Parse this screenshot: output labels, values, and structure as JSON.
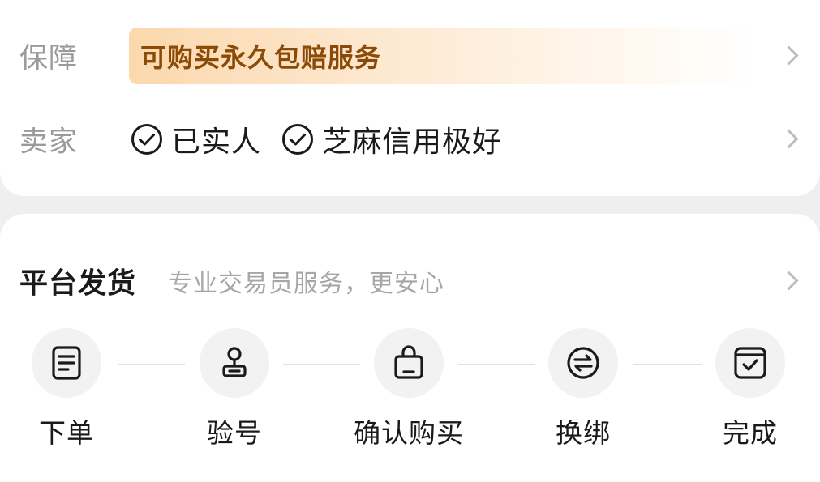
{
  "guarantee": {
    "label": "保障",
    "banner_text": "可购买永久包赔服务"
  },
  "seller": {
    "label": "卖家",
    "tags": [
      {
        "icon": "check-circle-icon",
        "text": "已实人"
      },
      {
        "icon": "check-circle-icon",
        "text": "芝麻信用极好"
      }
    ]
  },
  "platform_shipping": {
    "title": "平台发货",
    "subtitle": "专业交易员服务，更安心",
    "steps": [
      {
        "icon": "order-document-icon",
        "label": "下单"
      },
      {
        "icon": "stamp-icon",
        "label": "验号"
      },
      {
        "icon": "shopping-bag-icon",
        "label": "确认购买"
      },
      {
        "icon": "swap-icon",
        "label": "换绑"
      },
      {
        "icon": "checkbox-done-icon",
        "label": "完成"
      }
    ]
  },
  "colors": {
    "background": "#efefef",
    "card": "#ffffff",
    "banner_text": "#8b4a06",
    "banner_gradient_start": "#fbd8ad",
    "label_gray": "#9a9a9a",
    "subtitle_gray": "#a6a6a6",
    "icon_circle": "#f2f2f2",
    "text_dark": "#1a1a1a"
  }
}
